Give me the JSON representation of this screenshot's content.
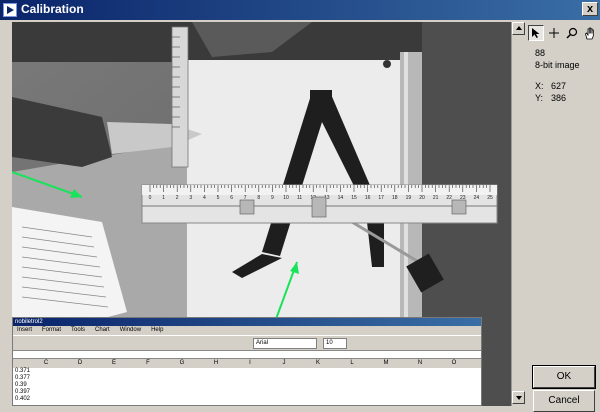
{
  "window": {
    "title": "Calibration",
    "close_label": "x"
  },
  "panel": {
    "tools": [
      "pointer-icon",
      "crosshair-icon",
      "zoom-icon",
      "pan-hand-icon"
    ],
    "value": "88",
    "image_type": "8-bit image",
    "x_label": "X:",
    "x_value": "627",
    "y_label": "Y:",
    "y_value": "386",
    "ok_label": "OK",
    "cancel_label": "Cancel"
  },
  "spreadsheet": {
    "title": "nobiletrol2",
    "menu": [
      "Insert",
      "Format",
      "Tools",
      "Chart",
      "Window",
      "Help"
    ],
    "font_name": "Arial",
    "font_size": "10",
    "columns": [
      "C",
      "D",
      "E",
      "F",
      "G",
      "H",
      "I",
      "J",
      "K",
      "L",
      "M",
      "N",
      "O"
    ],
    "row_values": [
      "0.371",
      "0.377",
      "0.39",
      "0.397",
      "0.402"
    ]
  },
  "ruler": {
    "labels": [
      "0",
      "1",
      "2",
      "3",
      "4",
      "5",
      "6",
      "7",
      "8",
      "9",
      "10",
      "11",
      "12",
      "13",
      "14",
      "15",
      "16",
      "17",
      "18",
      "19",
      "20",
      "21",
      "22",
      "23",
      "24",
      "25"
    ]
  },
  "colors": {
    "arrow": "#19e35a",
    "titlebar": "#0a246a"
  }
}
